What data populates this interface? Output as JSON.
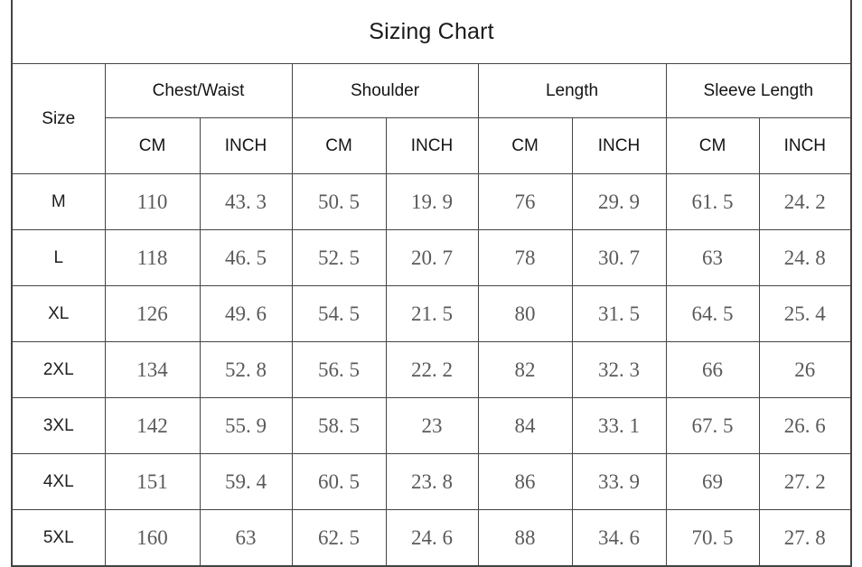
{
  "title": "Sizing Chart",
  "table": {
    "size_header": "Size",
    "measurement_groups": [
      {
        "label": "Chest/Waist",
        "units": [
          "CM",
          "INCH"
        ]
      },
      {
        "label": "Shoulder",
        "units": [
          "CM",
          "INCH"
        ]
      },
      {
        "label": "Length",
        "units": [
          "CM",
          "INCH"
        ]
      },
      {
        "label": "Sleeve Length",
        "units": [
          "CM",
          "INCH"
        ]
      }
    ],
    "rows": [
      {
        "size": "M",
        "cells": [
          "110",
          "43. 3",
          "50. 5",
          "19. 9",
          "76",
          "29. 9",
          "61. 5",
          "24. 2"
        ]
      },
      {
        "size": "L",
        "cells": [
          "118",
          "46. 5",
          "52. 5",
          "20. 7",
          "78",
          "30. 7",
          "63",
          "24. 8"
        ]
      },
      {
        "size": "XL",
        "cells": [
          "126",
          "49. 6",
          "54. 5",
          "21. 5",
          "80",
          "31. 5",
          "64. 5",
          "25. 4"
        ]
      },
      {
        "size": "2XL",
        "cells": [
          "134",
          "52. 8",
          "56. 5",
          "22. 2",
          "82",
          "32. 3",
          "66",
          "26"
        ]
      },
      {
        "size": "3XL",
        "cells": [
          "142",
          "55. 9",
          "58. 5",
          "23",
          "84",
          "33. 1",
          "67. 5",
          "26. 6"
        ]
      },
      {
        "size": "4XL",
        "cells": [
          "151",
          "59. 4",
          "60. 5",
          "23. 8",
          "86",
          "33. 9",
          "69",
          "27. 2"
        ]
      },
      {
        "size": "5XL",
        "cells": [
          "160",
          "63",
          "62. 5",
          "24. 6",
          "88",
          "34. 6",
          "70. 5",
          "27. 8"
        ]
      }
    ]
  },
  "colors": {
    "border": "#444444",
    "header_text": "#141414",
    "size_text": "#1f1f1f",
    "data_text": "#5a5a5a",
    "background": "#ffffff"
  }
}
